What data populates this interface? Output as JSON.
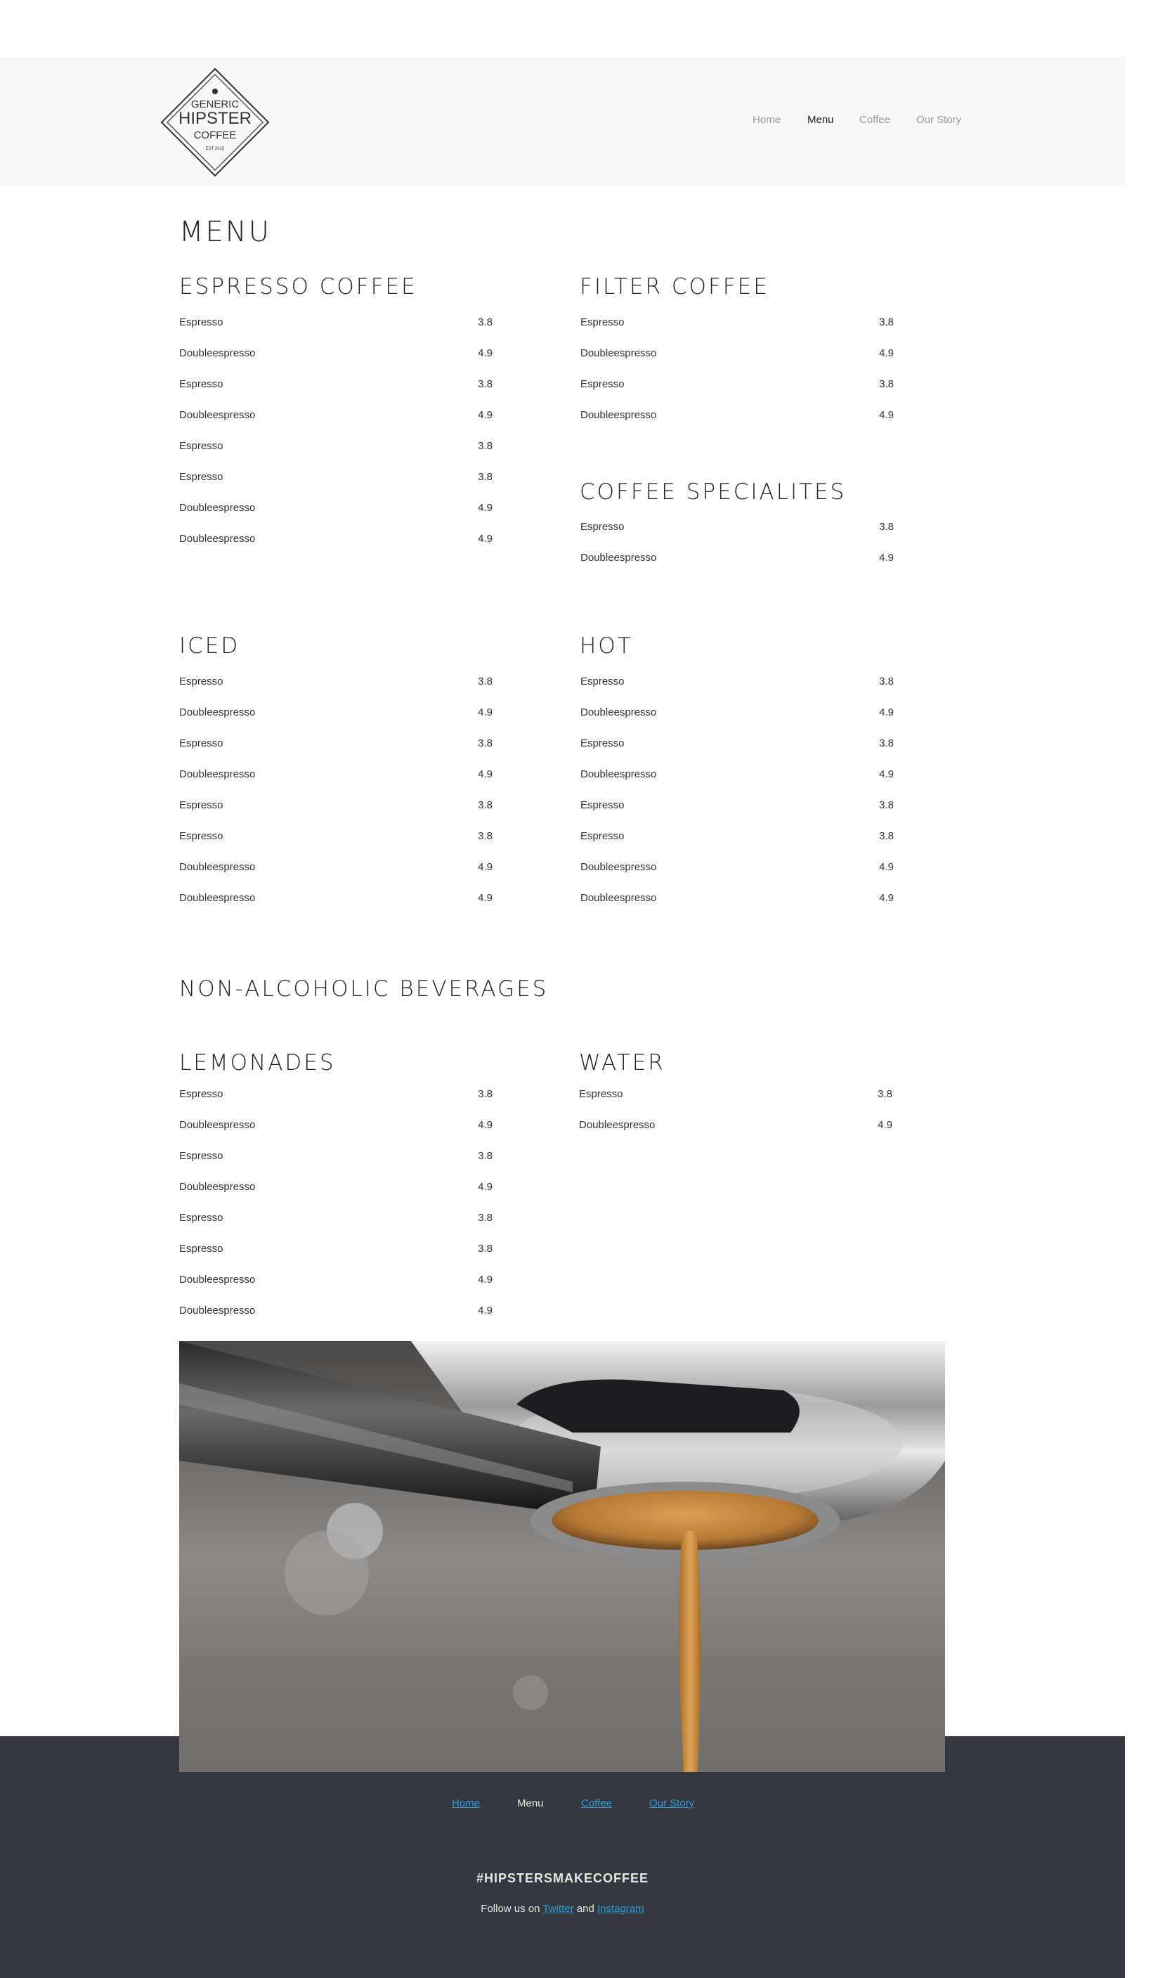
{
  "brand": {
    "logo_lines": [
      "GENERIC",
      "HIPSTER",
      "COFFEE"
    ],
    "logo_est": "EST 2015"
  },
  "nav": {
    "items": [
      {
        "label": "Home"
      },
      {
        "label": "Menu"
      },
      {
        "label": "Coffee"
      },
      {
        "label": "Our Story"
      }
    ]
  },
  "page_title": "MENU",
  "sections": {
    "espresso": {
      "title": "ESPRESSO COFFEE",
      "items": [
        {
          "name": "Espresso",
          "price": "3.8"
        },
        {
          "name": "Doubleespresso",
          "price": "4.9"
        },
        {
          "name": "Espresso",
          "price": "3.8"
        },
        {
          "name": "Doubleespresso",
          "price": "4.9"
        },
        {
          "name": "Espresso",
          "price": "3.8"
        },
        {
          "name": "Espresso",
          "price": "3.8"
        },
        {
          "name": "Doubleespresso",
          "price": "4.9"
        },
        {
          "name": "Doubleespresso",
          "price": "4.9"
        }
      ]
    },
    "filter": {
      "title": "FILTER COFFEE",
      "items": [
        {
          "name": "Espresso",
          "price": "3.8"
        },
        {
          "name": "Doubleespresso",
          "price": "4.9"
        },
        {
          "name": "Espresso",
          "price": "3.8"
        },
        {
          "name": "Doubleespresso",
          "price": "4.9"
        }
      ]
    },
    "specialites": {
      "title": "COFFEE SPECIALITES",
      "items": [
        {
          "name": "Espresso",
          "price": "3.8"
        },
        {
          "name": "Doubleespresso",
          "price": "4.9"
        }
      ]
    },
    "iced": {
      "title": "ICED",
      "items": [
        {
          "name": "Espresso",
          "price": "3.8"
        },
        {
          "name": "Doubleespresso",
          "price": "4.9"
        },
        {
          "name": "Espresso",
          "price": "3.8"
        },
        {
          "name": "Doubleespresso",
          "price": "4.9"
        },
        {
          "name": "Espresso",
          "price": "3.8"
        },
        {
          "name": "Espresso",
          "price": "3.8"
        },
        {
          "name": "Doubleespresso",
          "price": "4.9"
        },
        {
          "name": "Doubleespresso",
          "price": "4.9"
        }
      ]
    },
    "hot": {
      "title": "HOT",
      "items": [
        {
          "name": "Espresso",
          "price": "3.8"
        },
        {
          "name": "Doubleespresso",
          "price": "4.9"
        },
        {
          "name": "Espresso",
          "price": "3.8"
        },
        {
          "name": "Doubleespresso",
          "price": "4.9"
        },
        {
          "name": "Espresso",
          "price": "3.8"
        },
        {
          "name": "Espresso",
          "price": "3.8"
        },
        {
          "name": "Doubleespresso",
          "price": "4.9"
        },
        {
          "name": "Doubleespresso",
          "price": "4.9"
        }
      ]
    },
    "non_alcoholic_title": "NON-ALCOHOLIC BEVERAGES",
    "lemonades": {
      "title": "LEMONADES",
      "items": [
        {
          "name": "Espresso",
          "price": "3.8"
        },
        {
          "name": "Doubleespresso",
          "price": "4.9"
        },
        {
          "name": "Espresso",
          "price": "3.8"
        },
        {
          "name": "Doubleespresso",
          "price": "4.9"
        },
        {
          "name": "Espresso",
          "price": "3.8"
        },
        {
          "name": "Espresso",
          "price": "3.8"
        },
        {
          "name": "Doubleespresso",
          "price": "4.9"
        },
        {
          "name": "Doubleespresso",
          "price": "4.9"
        }
      ]
    },
    "water": {
      "title": "WATER",
      "items": [
        {
          "name": "Espresso",
          "price": "3.8"
        },
        {
          "name": "Doubleespresso",
          "price": "4.9"
        }
      ]
    }
  },
  "footer": {
    "nav": [
      {
        "label": "Home"
      },
      {
        "label": "Menu"
      },
      {
        "label": "Coffee"
      },
      {
        "label": "Our Story"
      }
    ],
    "tagline": "#HIPSTERSMAKECOFFEE",
    "follow_prefix": "Follow us on",
    "follow_twitter": "Twitter",
    "follow_and": "and",
    "follow_instagram": "Instagram"
  },
  "colors": {
    "header_bg": "#f7f8f9",
    "footer_bg": "#353840",
    "link": "#2f9bd6",
    "text": "#222222"
  },
  "icons": {
    "logo": "diamond-badge-logo"
  }
}
